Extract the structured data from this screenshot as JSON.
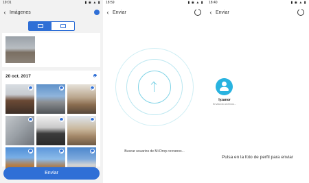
{
  "screens": [
    {
      "status": {
        "time": "19:01",
        "icons": "▮ ◉ ▲ ▮"
      },
      "title": "Imágenes",
      "date_header": "20 oct. 2017",
      "send_button": "Enviar"
    },
    {
      "status": {
        "time": "18:59",
        "icons": "▮ ◉ ▲ ▮"
      },
      "title": "Enviar",
      "search_text": "Buscar usuarios de Mi Drop cercanos..."
    },
    {
      "status": {
        "time": "18:40",
        "icons": "▮ ◉ ▲ ▮"
      },
      "title": "Enviar",
      "peer": {
        "name": "lyzanor",
        "status": "Enviando archivos..."
      },
      "hint": "Pulsa en la foto de perfil para enviar"
    }
  ],
  "colors": {
    "accent": "#2f6fd6",
    "radar": "#7fd3e6",
    "avatar": "#29b3e0"
  },
  "icons": [
    "back-arrow-icon",
    "image-icon",
    "check-icon",
    "upload-arrow-icon",
    "user-icon",
    "refresh-icon"
  ]
}
